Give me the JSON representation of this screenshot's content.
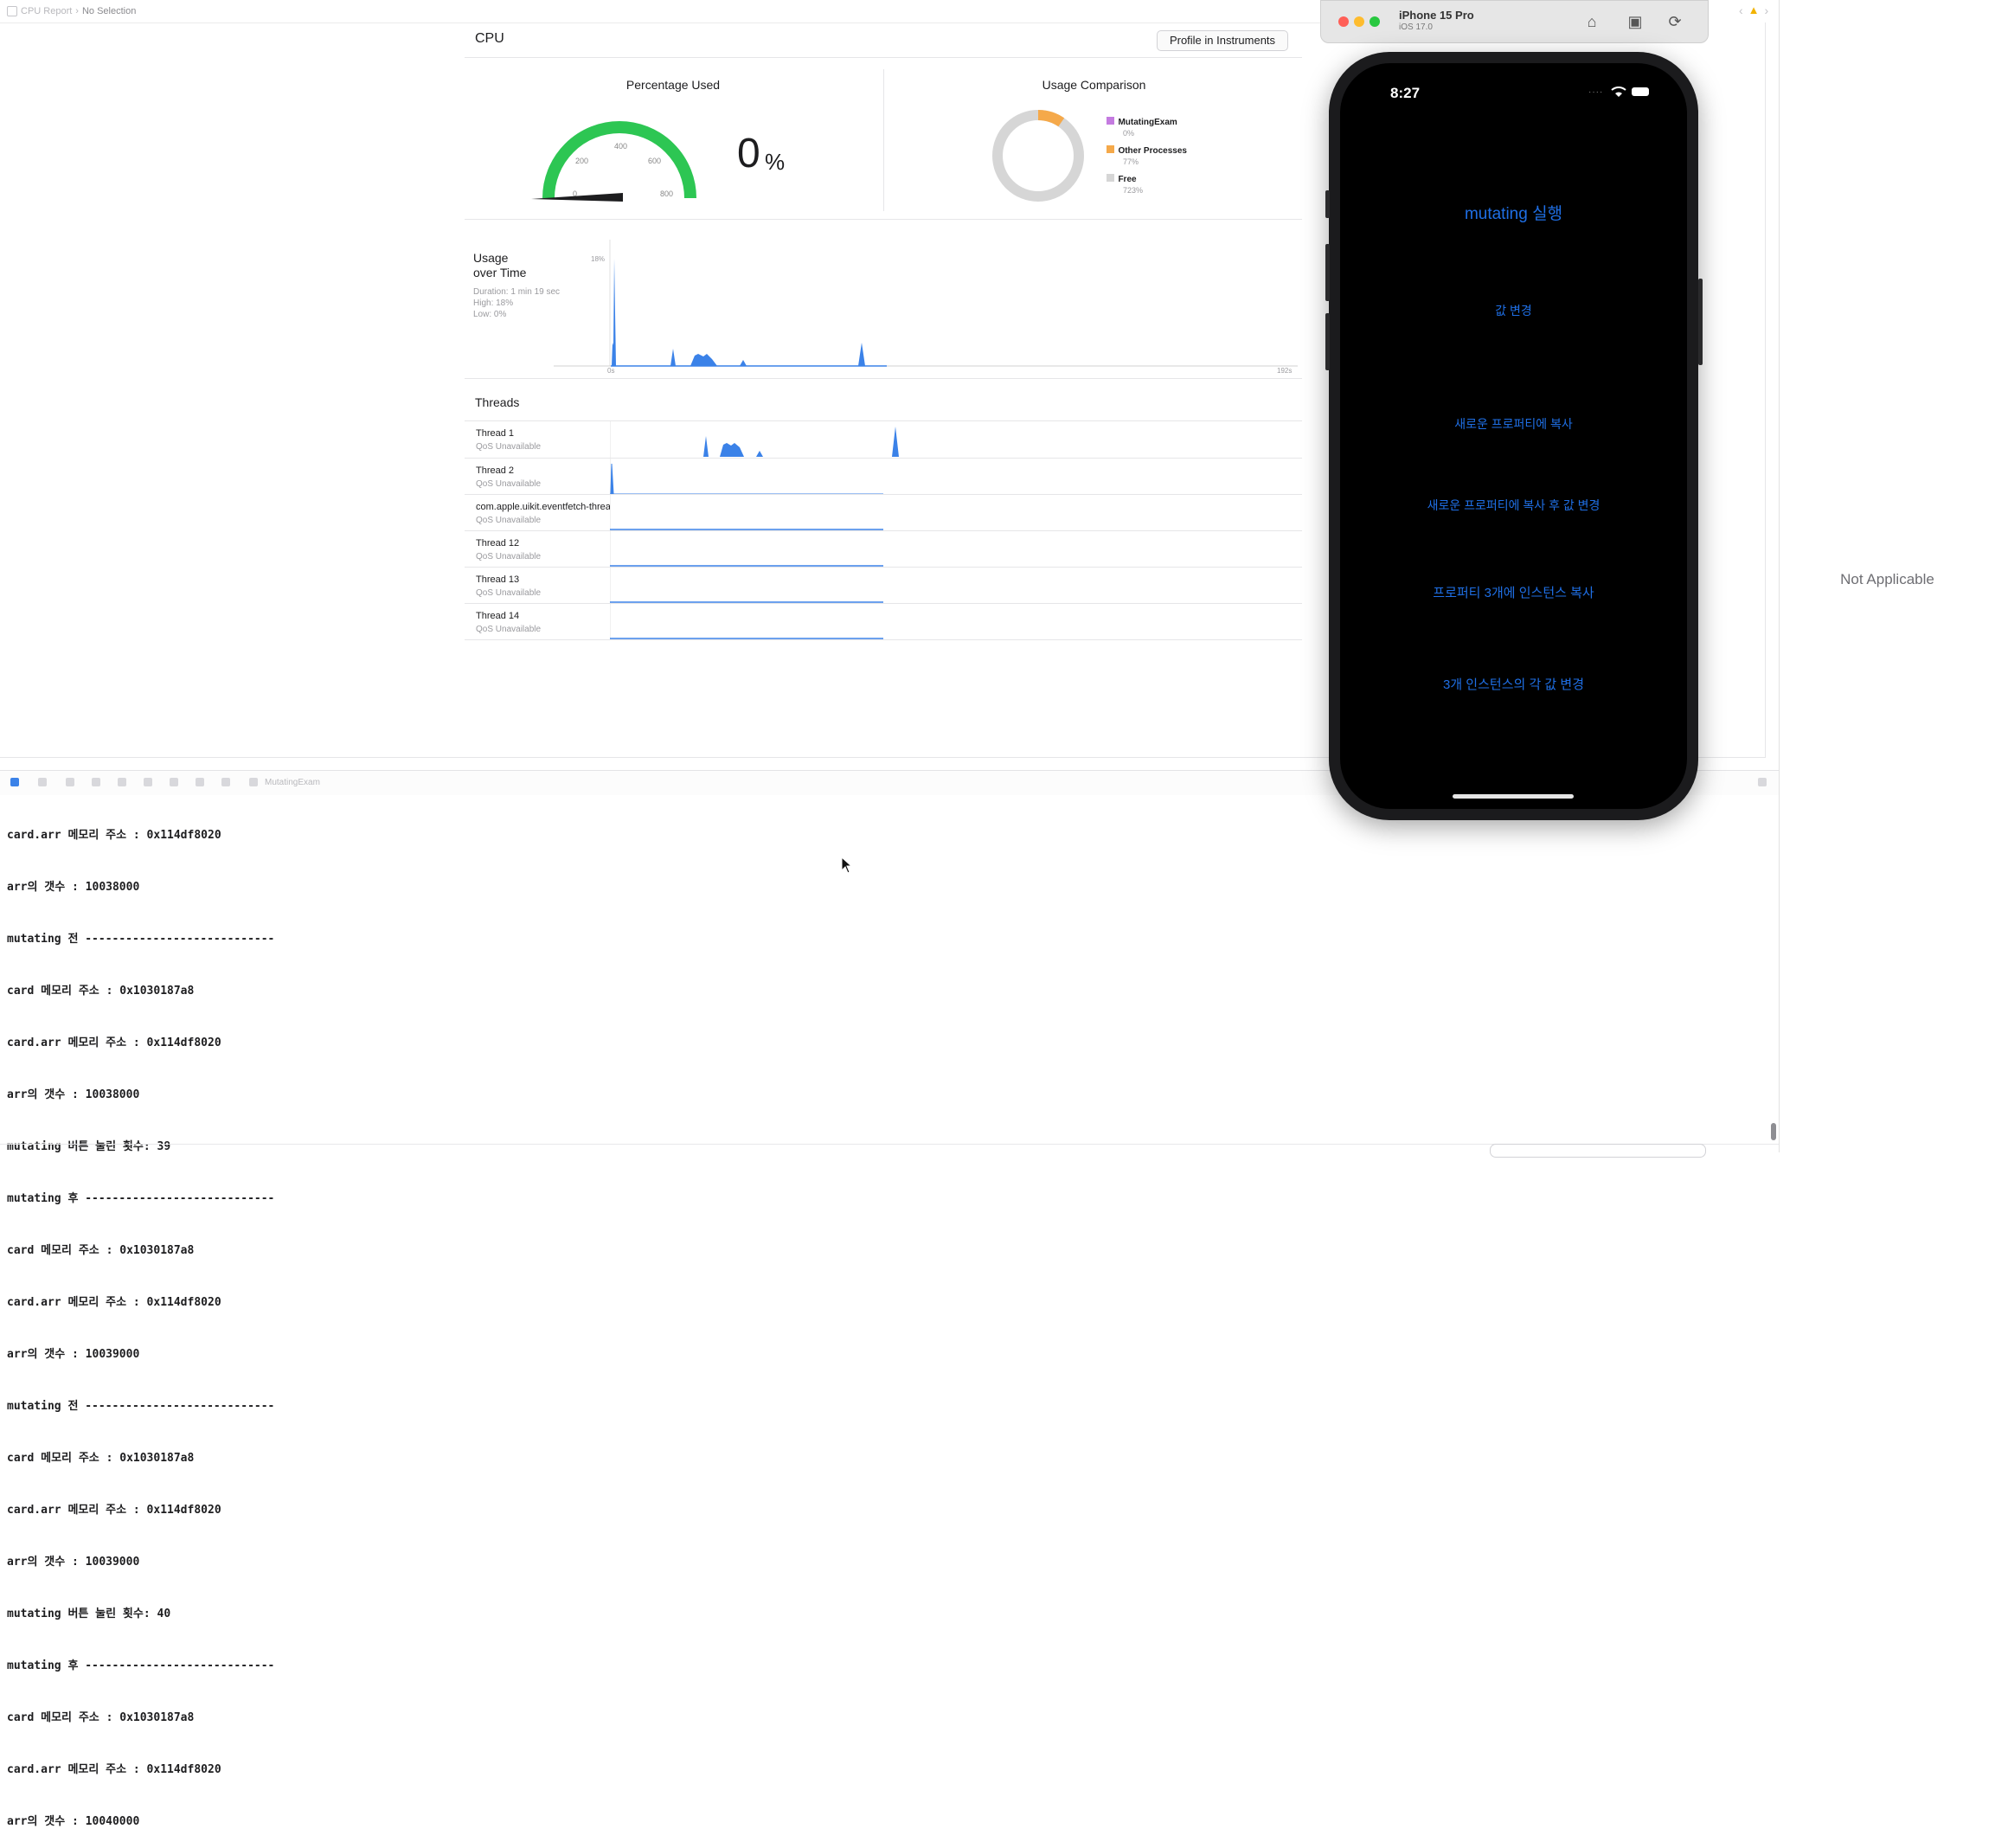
{
  "breadcrumb": {
    "root": "CPU Report",
    "selection": "No Selection"
  },
  "cpu_report": {
    "title": "CPU",
    "profile_button": "Profile in Instruments",
    "percentage_used": {
      "title": "Percentage Used",
      "value": "0",
      "unit": "%",
      "gauge_ticks": [
        "0",
        "200",
        "400",
        "600",
        "800"
      ]
    },
    "usage_comparison": {
      "title": "Usage Comparison",
      "legend": [
        {
          "name": "MutatingExam",
          "value": "0%",
          "color": "#c47be0"
        },
        {
          "name": "Other Processes",
          "value": "77%",
          "color": "#f5a94a"
        },
        {
          "name": "Free",
          "value": "723%",
          "color": "#d6d6d6"
        }
      ]
    },
    "usage_over_time": {
      "title_line1": "Usage",
      "title_line2": "over Time",
      "duration": "Duration: 1 min 19 sec",
      "high": "High: 18%",
      "low": "Low: 0%",
      "y_max_label": "18%",
      "x_start_label": "0s",
      "x_end_label": "192s"
    },
    "threads": {
      "title": "Threads",
      "items": [
        {
          "name": "Thread 1",
          "qos": "QoS Unavailable"
        },
        {
          "name": "Thread 2",
          "qos": "QoS Unavailable"
        },
        {
          "name": "com.apple.uikit.eventfetch-thread",
          "qos": "QoS Unavailable"
        },
        {
          "name": "Thread 12",
          "qos": "QoS Unavailable"
        },
        {
          "name": "Thread 13",
          "qos": "QoS Unavailable"
        },
        {
          "name": "Thread 14",
          "qos": "QoS Unavailable"
        }
      ]
    }
  },
  "debug_bar": {
    "target": "MutatingExam"
  },
  "console": {
    "lines": [
      "card.arr 메모리 주소 : 0x114df8020",
      "arr의 갯수 : 10038000",
      "mutating 전 ----------------------------",
      "card 메모리 주소 : 0x1030187a8",
      "card.arr 메모리 주소 : 0x114df8020",
      "arr의 갯수 : 10038000",
      "mutating 버튼 눌린 횟수: 39",
      "mutating 후 ----------------------------",
      "card 메모리 주소 : 0x1030187a8",
      "card.arr 메모리 주소 : 0x114df8020",
      "arr의 갯수 : 10039000",
      "mutating 전 ----------------------------",
      "card 메모리 주소 : 0x1030187a8",
      "card.arr 메모리 주소 : 0x114df8020",
      "arr의 갯수 : 10039000",
      "mutating 버튼 눌린 횟수: 40",
      "mutating 후 ----------------------------",
      "card 메모리 주소 : 0x1030187a8",
      "card.arr 메모리 주소 : 0x114df8020",
      "arr의 갯수 : 10040000"
    ]
  },
  "inspector": {
    "placeholder": "Not Applicable"
  },
  "simulator": {
    "device_name": "iPhone 15 Pro",
    "os_version": "iOS 17.0",
    "status_time": "8:27",
    "buttons": [
      "mutating 실행",
      "값 변경",
      "새로운 프로퍼티에 복사",
      "새로운 프로퍼티에 복사 후 값 변경",
      "프로퍼티 3개에 인스턴스 복사",
      "3개 인스턴스의 각 값 변경"
    ]
  }
}
